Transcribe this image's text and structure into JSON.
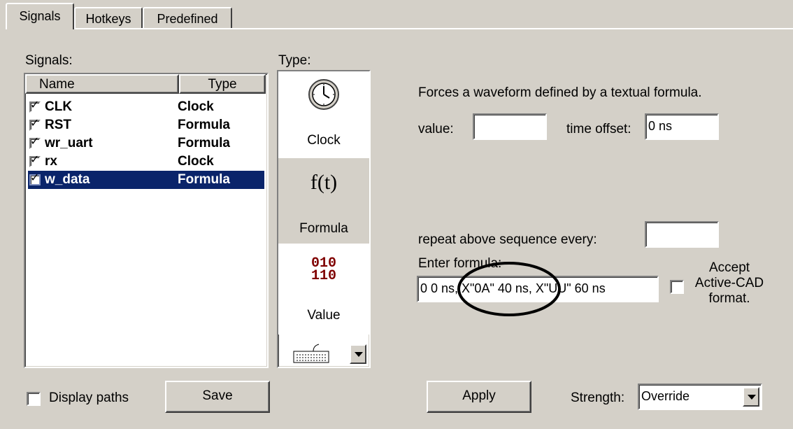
{
  "tabs": [
    "Signals",
    "Hotkeys",
    "Predefined"
  ],
  "signals_label": "Signals:",
  "type_label": "Type:",
  "list": {
    "headers": [
      "Name",
      "Type"
    ],
    "rows": [
      {
        "name": "CLK",
        "type": "Clock",
        "checked": true
      },
      {
        "name": "RST",
        "type": "Formula",
        "checked": true
      },
      {
        "name": "wr_uart",
        "type": "Formula",
        "checked": true
      },
      {
        "name": "rx",
        "type": "Clock",
        "checked": true
      },
      {
        "name": "w_data",
        "type": "Formula",
        "checked": true,
        "selected": true
      }
    ]
  },
  "type_options": [
    {
      "label": "Clock",
      "icon": "clock-icon"
    },
    {
      "label": "Formula",
      "icon_text": "f(t)",
      "icon": "formula-icon",
      "selected": true
    },
    {
      "label": "Value",
      "icon_text_1": "010",
      "icon_text_2": "110",
      "icon": "binary-value-icon"
    }
  ],
  "description": "Forces a waveform defined by a textual formula.",
  "value_label": "value:",
  "value": "",
  "time_offset_label": "time offset:",
  "time_offset": "0 ns",
  "repeat_label": "repeat above sequence every:",
  "repeat_value": "",
  "formula_label": "Enter formula:",
  "formula": "0 0 ns, X\"0A\" 40 ns, X\"UU\" 60 ns",
  "accept_label_1": "Accept",
  "accept_label_2": "Active-CAD",
  "accept_label_3": "format.",
  "display_paths": "Display paths",
  "save": "Save",
  "apply": "Apply",
  "strength_label": "Strength:",
  "strength": "Override",
  "colors": {
    "selection": "#0a246a",
    "value_icon": "#800000",
    "face": "#d4d0c8"
  }
}
